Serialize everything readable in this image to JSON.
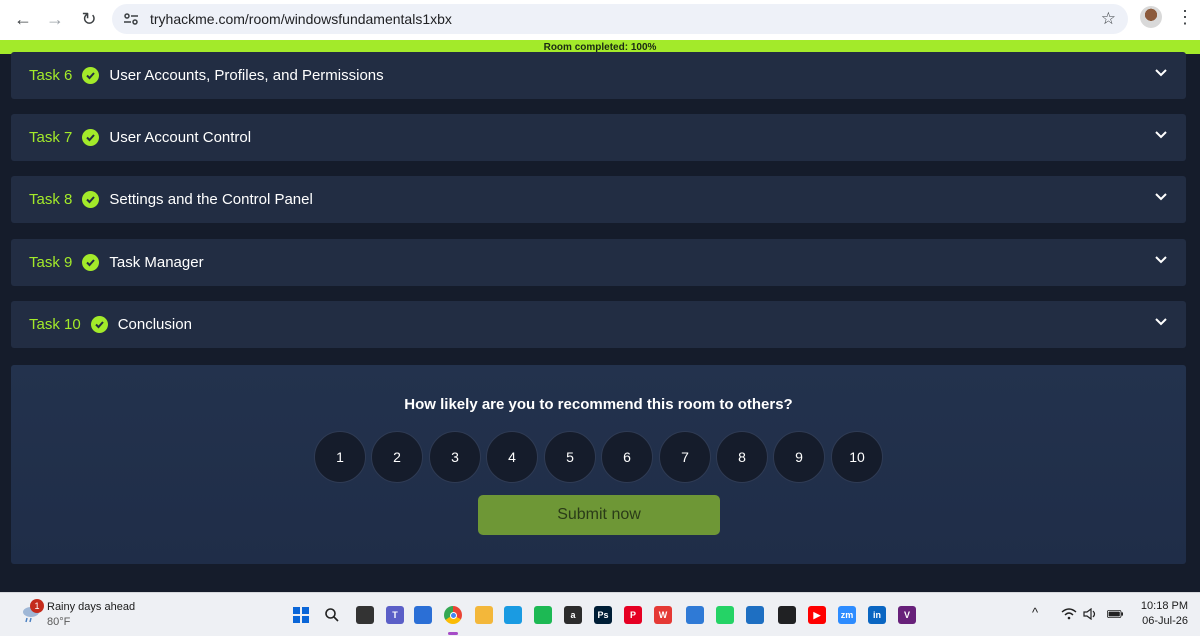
{
  "browser": {
    "url": "tryhackme.com/room/windowsfundamentals1xbx"
  },
  "progress_banner": {
    "text": "Room completed: 100%",
    "percent": 100
  },
  "tasks": [
    {
      "number": "Task 6",
      "title": "User Accounts, Profiles, and Permissions",
      "completed": true
    },
    {
      "number": "Task 7",
      "title": "User Account Control",
      "completed": true
    },
    {
      "number": "Task 8",
      "title": "Settings and the Control Panel",
      "completed": true
    },
    {
      "number": "Task 9",
      "title": "Task Manager",
      "completed": true
    },
    {
      "number": "Task 10",
      "title": "Conclusion",
      "completed": true
    }
  ],
  "survey": {
    "question": "How likely are you to recommend this room to others?",
    "ratings": [
      "1",
      "2",
      "3",
      "4",
      "5",
      "6",
      "7",
      "8",
      "9",
      "10"
    ],
    "submit_label": "Submit now"
  },
  "taskbar": {
    "weather": {
      "badge": "1",
      "title": "Rainy days ahead",
      "temp": "80°F"
    },
    "clock": {
      "time": "10:18 PM",
      "date": "06-Jul-26"
    },
    "apps": [
      {
        "name": "start-icon",
        "color": "#0a66d8",
        "label": ""
      },
      {
        "name": "search-icon",
        "color": "",
        "label": ""
      },
      {
        "name": "task-view-icon",
        "color": "#333333",
        "label": ""
      },
      {
        "name": "teams-icon",
        "color": "#5b5fc7",
        "label": "T"
      },
      {
        "name": "store-icon",
        "color": "#2b6fd6",
        "label": ""
      },
      {
        "name": "chrome-icon",
        "color": "#ea4335",
        "label": ""
      },
      {
        "name": "file-explorer-icon",
        "color": "#f3b73a",
        "label": ""
      },
      {
        "name": "edge-icon",
        "color": "#1a9be2",
        "label": ""
      },
      {
        "name": "app-green-icon",
        "color": "#1db954",
        "label": ""
      },
      {
        "name": "app-a-icon",
        "color": "#2c2c2c",
        "label": "a"
      },
      {
        "name": "photoshop-icon",
        "color": "#001e36",
        "label": "Ps"
      },
      {
        "name": "pinterest-icon",
        "color": "#e60023",
        "label": "P"
      },
      {
        "name": "wps-icon",
        "color": "#e53935",
        "label": "W"
      },
      {
        "name": "notepad-icon",
        "color": "#2f7ad6",
        "label": ""
      },
      {
        "name": "whatsapp-icon",
        "color": "#25d366",
        "label": ""
      },
      {
        "name": "calendar-icon",
        "color": "#1e6fc2",
        "label": ""
      },
      {
        "name": "chatgpt-icon",
        "color": "#202123",
        "label": ""
      },
      {
        "name": "youtube-icon",
        "color": "#ff0000",
        "label": "▶"
      },
      {
        "name": "zoom-icon",
        "color": "#2d8cff",
        "label": "zm"
      },
      {
        "name": "linkedin-icon",
        "color": "#0a66c2",
        "label": "in"
      },
      {
        "name": "vs-icon",
        "color": "#68217a",
        "label": "V"
      }
    ]
  }
}
